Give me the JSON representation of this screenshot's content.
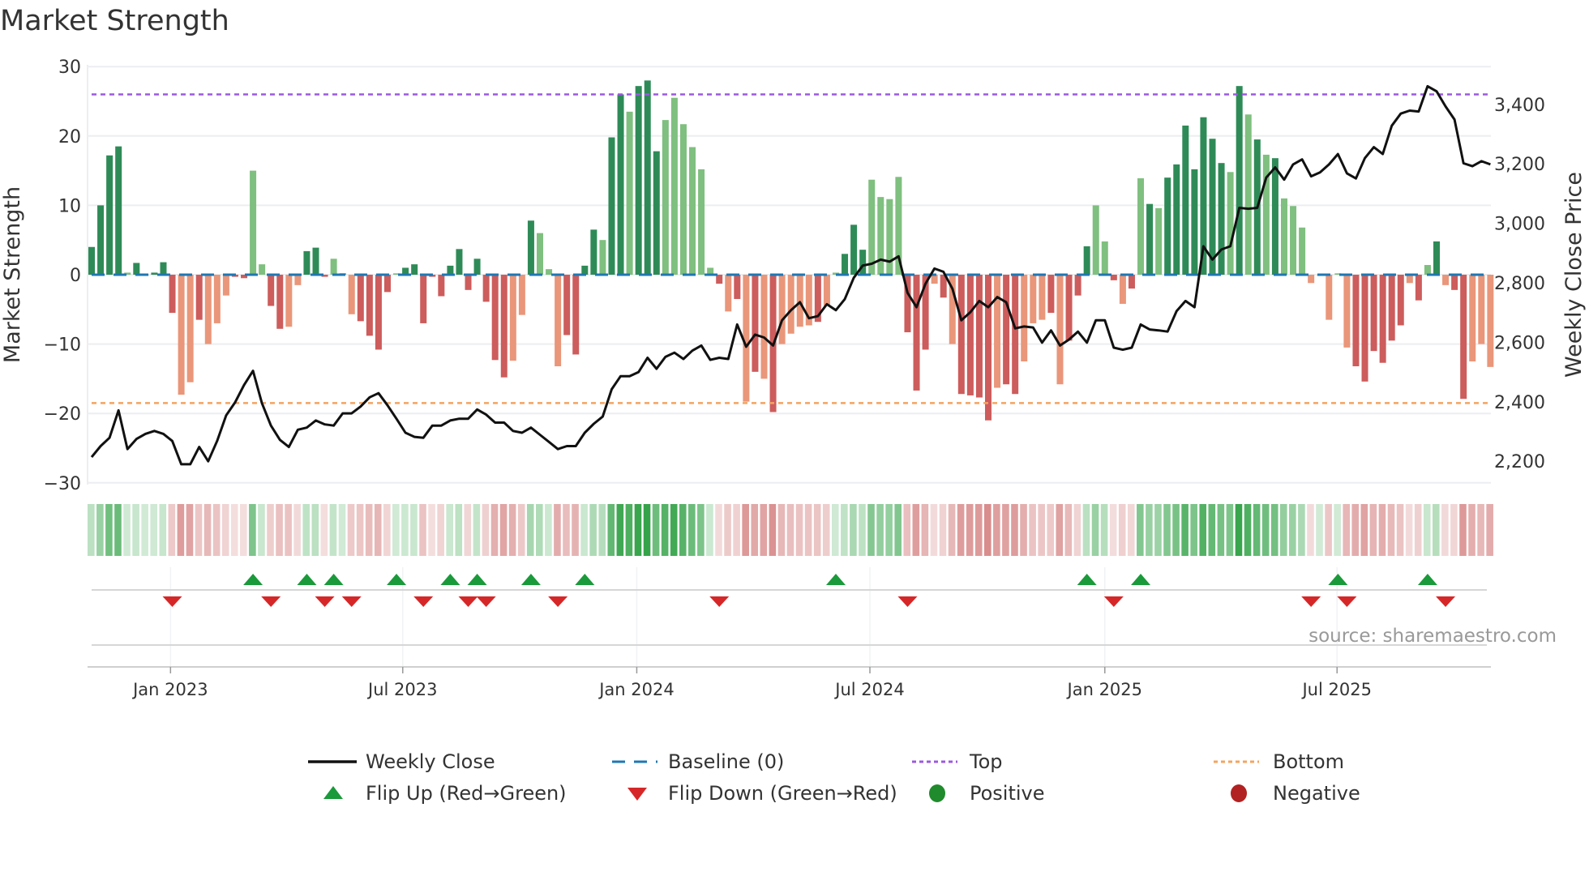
{
  "title": "Market Strength",
  "source": "source: sharemaestro.com",
  "chart_data": {
    "type": "bar",
    "title": "Market Strength",
    "ylabel": "Market Strength",
    "y2label": "Weekly Close Price",
    "ylim": [
      -30,
      30
    ],
    "y2lim": [
      2125,
      3526
    ],
    "yticks": [
      30,
      20,
      10,
      0,
      -10,
      -20,
      -30
    ],
    "yticklabels": [
      "30",
      "20",
      "10",
      "0",
      "−10",
      "−20",
      "−30"
    ],
    "y2ticks": [
      3400,
      3200,
      3000,
      2800,
      2600,
      2400,
      2200
    ],
    "y2ticklabels": [
      "3,400",
      "3,200",
      "3,000",
      "2,800",
      "2,600",
      "2,400",
      "2,200"
    ],
    "xticks": [
      {
        "label": "Jan 2023",
        "week": 8.8
      },
      {
        "label": "Jul 2023",
        "week": 34.7
      },
      {
        "label": "Jan 2024",
        "week": 60.8
      },
      {
        "label": "Jul 2024",
        "week": 86.8
      },
      {
        "label": "Jan 2025",
        "week": 113
      },
      {
        "label": "Jul 2025",
        "week": 138.9
      }
    ],
    "grid": true,
    "top_level": 26,
    "bottom_level": -18.5,
    "baseline": 0,
    "strength": [
      4,
      10,
      17.2,
      18.5,
      0.3,
      1.7,
      0,
      0.3,
      1.8,
      -5.5,
      -17.3,
      -15.5,
      -6.5,
      -10,
      -7,
      -3,
      -0.3,
      -0.5,
      15,
      1.5,
      -4.5,
      -7.8,
      -7.5,
      -1.5,
      3.4,
      3.9,
      -0.3,
      2.3,
      0.2,
      -5.7,
      -6.7,
      -8.8,
      -10.8,
      -2.5,
      0.2,
      1,
      1.5,
      -7,
      -0.3,
      -3.1,
      1.3,
      3.7,
      -2.2,
      2.3,
      -3.9,
      -12.3,
      -14.8,
      -12.4,
      -5.8,
      7.8,
      6,
      0.8,
      -13.2,
      -8.7,
      -11.5,
      1.3,
      6.5,
      5,
      19.8,
      26,
      23.5,
      27.2,
      28,
      17.8,
      22.3,
      25.5,
      21.7,
      18.4,
      15.2,
      1,
      -1.3,
      -5.3,
      -3.5,
      -18.3,
      -14,
      -15,
      -19.8,
      -10,
      -8.5,
      -7.5,
      -7.3,
      -6.8,
      -4.5,
      0.3,
      3,
      7.2,
      3.6,
      13.7,
      11.2,
      10.9,
      14.1,
      -8.3,
      -16.7,
      -10.8,
      -1.3,
      -3.3,
      -10,
      -17.2,
      -17.4,
      -17.7,
      -21,
      -16.3,
      -15.8,
      -17.2,
      -12.5,
      -7,
      -6.5,
      -5.5,
      -15.8,
      -9.5,
      -3,
      4.1,
      10,
      4.8,
      -0.8,
      -4.2,
      -2,
      13.9,
      10.2,
      9.6,
      14,
      15.9,
      21.5,
      15.2,
      22.7,
      19.6,
      16.1,
      14.8,
      27.2,
      23.1,
      19.5,
      17.3,
      16.8,
      11,
      9.9,
      6.8,
      -1.2,
      0,
      -6.5,
      0.2,
      -10.5,
      -13.2,
      -15.4,
      -11,
      -12.7,
      -9.5,
      -7.3,
      -1.2,
      -3.7,
      1.4,
      4.8,
      -1.5,
      -2.2,
      -17.9,
      -12.5,
      -10,
      -13.3
    ],
    "shade": "ddddldddddlldlllddllddlldddldlddddlddddddddddddlldlllddddlddldddlllllldldldldlllldlldddlllldddldlddddlddllldldddlldldldldddddddldldldllllllllddddddldldlddlllldddddddlll",
    "weekly_close": [
      2214,
      2251,
      2279,
      2371,
      2241,
      2275,
      2292,
      2302,
      2292,
      2268,
      2190,
      2190,
      2248,
      2200,
      2268,
      2354,
      2398,
      2456,
      2504,
      2395,
      2320,
      2272,
      2248,
      2306,
      2313,
      2337,
      2324,
      2320,
      2361,
      2361,
      2384,
      2415,
      2429,
      2388,
      2343,
      2296,
      2282,
      2279,
      2320,
      2320,
      2337,
      2343,
      2343,
      2374,
      2357,
      2330,
      2330,
      2302,
      2296,
      2313,
      2289,
      2265,
      2241,
      2251,
      2251,
      2296,
      2326,
      2350,
      2442,
      2486,
      2486,
      2500,
      2548,
      2511,
      2551,
      2565,
      2544,
      2572,
      2589,
      2541,
      2548,
      2544,
      2660,
      2585,
      2626,
      2616,
      2589,
      2674,
      2708,
      2735,
      2681,
      2688,
      2728,
      2708,
      2745,
      2817,
      2858,
      2864,
      2878,
      2871,
      2889,
      2766,
      2718,
      2797,
      2848,
      2837,
      2780,
      2674,
      2701,
      2739,
      2718,
      2752,
      2735,
      2647,
      2653,
      2650,
      2599,
      2640,
      2589,
      2609,
      2636,
      2599,
      2674,
      2674,
      2582,
      2575,
      2582,
      2660,
      2643,
      2640,
      2636,
      2705,
      2739,
      2718,
      2923,
      2878,
      2912,
      2923,
      3052,
      3049,
      3052,
      3154,
      3188,
      3147,
      3198,
      3215,
      3158,
      3171,
      3198,
      3233,
      3168,
      3151,
      3219,
      3256,
      3233,
      3328,
      3369,
      3379,
      3376,
      3461,
      3444,
      3393,
      3349,
      3202,
      3192,
      3209,
      3198
    ],
    "flip_up_weeks": [
      18,
      24,
      27,
      34,
      40,
      43,
      49,
      55,
      83,
      111,
      117,
      139,
      149
    ],
    "flip_down_weeks": [
      9,
      20,
      26,
      29,
      37,
      42,
      44,
      52,
      70,
      91,
      114,
      136,
      140,
      151
    ],
    "legend": [
      {
        "label": "Weekly Close",
        "marker": "line",
        "color": "#111111"
      },
      {
        "label": "Baseline (0)",
        "marker": "dash",
        "color": "#1f77b4"
      },
      {
        "label": "Top",
        "marker": "dot",
        "color": "#9b59e0"
      },
      {
        "label": "Bottom",
        "marker": "dot",
        "color": "#f4a460"
      },
      {
        "label": "Flip Up (Red→Green)",
        "marker": "triangle-up",
        "color": "#1a9a3a"
      },
      {
        "label": "Flip Down (Green→Red)",
        "marker": "triangle-down",
        "color": "#d62728"
      },
      {
        "label": "Positive",
        "marker": "circle",
        "color": "#1f8b2c"
      },
      {
        "label": "Negative",
        "marker": "circle",
        "color": "#b22222"
      }
    ],
    "legend_position": "bottom",
    "colors": {
      "pos_strong": "#2e8b57",
      "pos_weak": "#7fbf7f",
      "neg_strong": "#cd5c5c",
      "neg_weak": "#e9967a"
    }
  }
}
